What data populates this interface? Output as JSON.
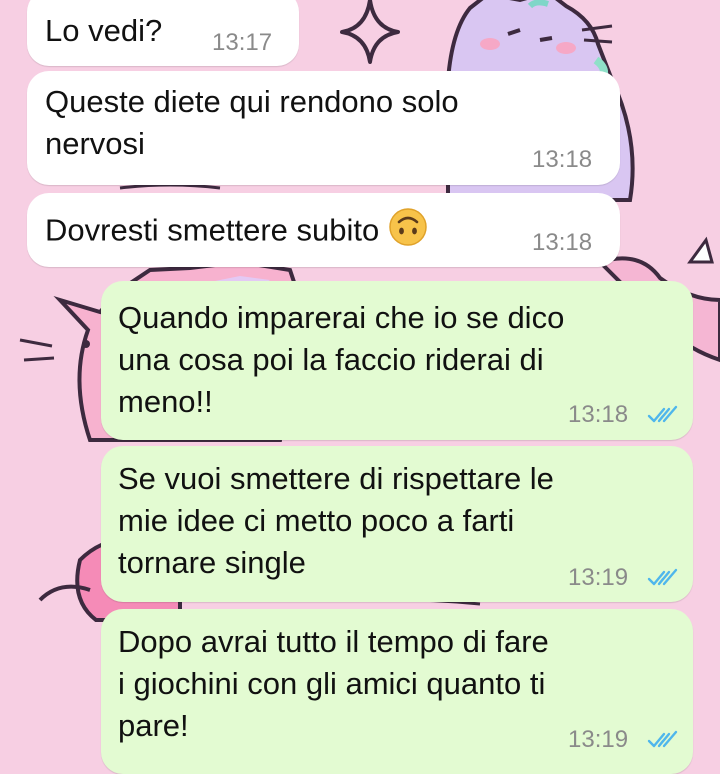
{
  "messages": [
    {
      "direction": "in",
      "text": "Lo vedi?",
      "time": "13:17"
    },
    {
      "direction": "in",
      "text": "Queste diete qui rendono solo\nnervosi",
      "time": "13:18"
    },
    {
      "direction": "in",
      "text": "Dovresti smettere subito",
      "emoji": "upside-down-face-icon",
      "time": "13:18"
    },
    {
      "direction": "out",
      "text": "Quando imparerai che io se dico\nuna cosa poi la faccio riderai di\nmeno!!",
      "time": "13:18",
      "status": "read"
    },
    {
      "direction": "out",
      "text": "Se vuoi smettere di rispettare le\nmie idee ci metto poco a farti\ntornare single",
      "time": "13:19",
      "status": "read"
    },
    {
      "direction": "out",
      "text": "Dopo avrai tutto il tempo di fare\ni giochini con gli amici quanto ti\npare!",
      "time": "13:19",
      "status": "read"
    }
  ],
  "colors": {
    "wallpaper": "#f7cfe3",
    "incoming_bubble": "#ffffff",
    "outgoing_bubble": "#e3fbd2",
    "timestamp": "#8a8a8a",
    "read_ticks": "#4fb6ec"
  }
}
